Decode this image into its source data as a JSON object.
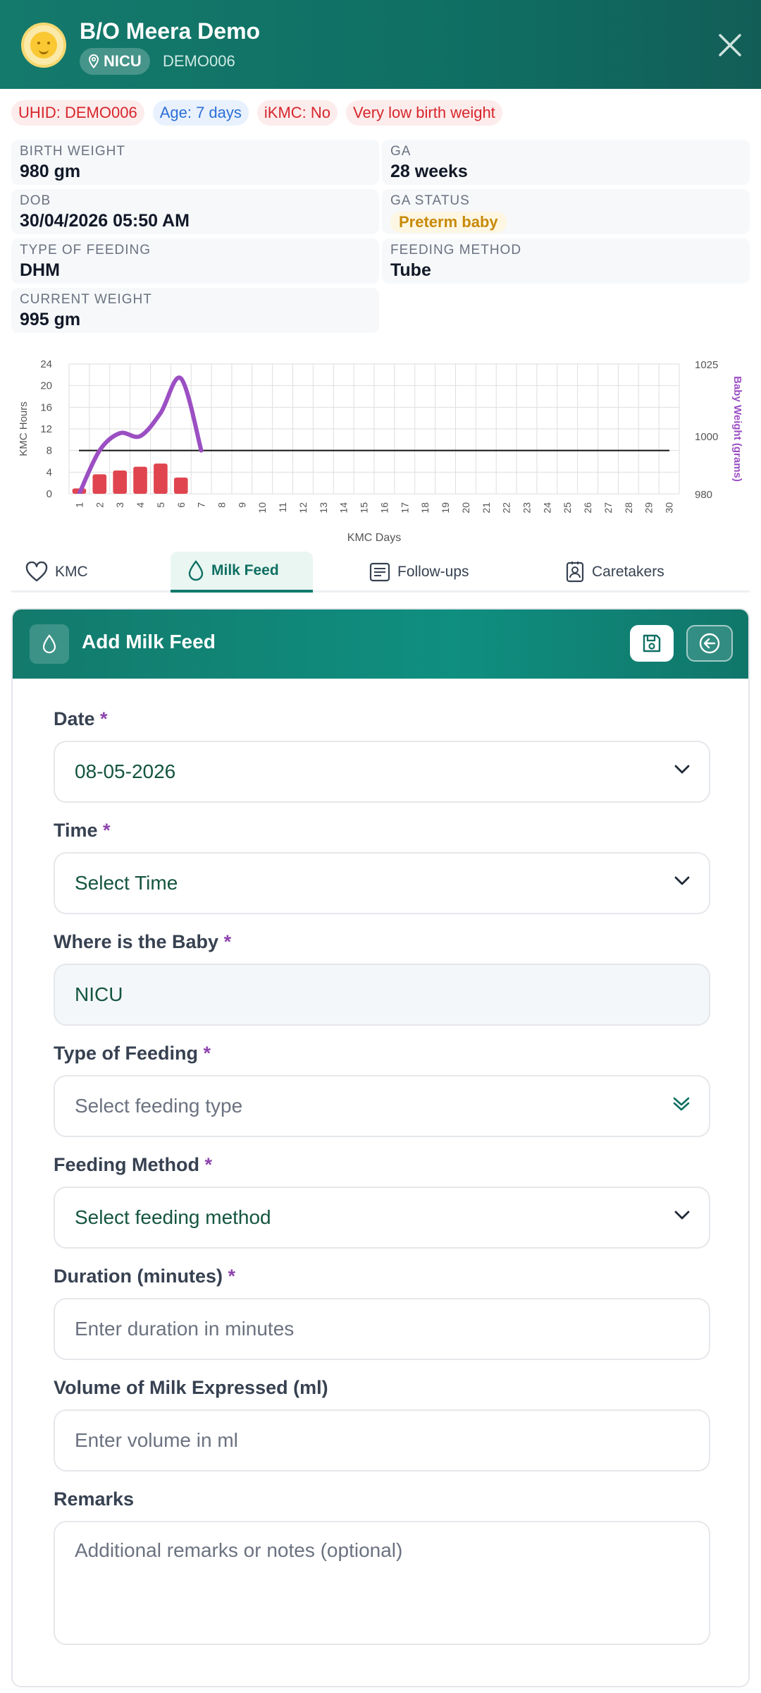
{
  "patient": {
    "name": "B/O Meera Demo",
    "location": "NICU",
    "code": "DEMO006"
  },
  "badges": [
    {
      "text": "UHID: DEMO006",
      "tone": "red"
    },
    {
      "text": "Age: 7 days",
      "tone": "blue"
    },
    {
      "text": "iKMC: No",
      "tone": "red"
    },
    {
      "text": "Very low birth weight",
      "tone": "red"
    }
  ],
  "info": {
    "birth_weight": {
      "label": "BIRTH WEIGHT",
      "value": "980 gm"
    },
    "ga": {
      "label": "GA",
      "value": "28 weeks"
    },
    "dob": {
      "label": "DOB",
      "value": "30/04/2026 05:50 AM"
    },
    "ga_status": {
      "label": "GA STATUS",
      "value": "Preterm baby"
    },
    "type_of_feeding": {
      "label": "TYPE OF FEEDING",
      "value": "DHM"
    },
    "feeding_method": {
      "label": "FEEDING METHOD",
      "value": "Tube"
    },
    "current_weight": {
      "label": "CURRENT WEIGHT",
      "value": "995 gm"
    }
  },
  "chart_data": {
    "type": "bar",
    "xlabel": "KMC Days",
    "ylabel": "KMC Hours",
    "y2label": "Baby Weight (grams)",
    "categories": [
      "1",
      "2",
      "3",
      "4",
      "5",
      "6",
      "7",
      "8",
      "9",
      "10",
      "11",
      "12",
      "13",
      "14",
      "15",
      "16",
      "17",
      "18",
      "19",
      "20",
      "21",
      "22",
      "23",
      "24",
      "25",
      "26",
      "27",
      "28",
      "29",
      "30"
    ],
    "ylim": [
      0,
      24
    ],
    "yticks": [
      0,
      4,
      8,
      12,
      16,
      20,
      24
    ],
    "y2lim": [
      980,
      1025
    ],
    "y2ticks": [
      980,
      1000,
      1025
    ],
    "series": [
      {
        "type": "bar",
        "values": [
          1,
          3.6,
          4.3,
          5,
          5.6,
          3,
          null,
          null,
          null,
          null,
          null,
          null,
          null,
          null,
          null,
          null,
          null,
          null,
          null,
          null,
          null,
          null,
          null,
          null,
          null,
          null,
          null,
          null,
          null,
          null
        ],
        "color": "#e0454f"
      },
      {
        "type": "line",
        "axis": "right",
        "x": [
          1,
          2,
          3,
          4,
          5,
          6,
          7
        ],
        "values": [
          980,
          995,
          1001,
          1000,
          1008,
          1020,
          995
        ],
        "color": "#9b4fc3"
      },
      {
        "type": "hline",
        "value": 8,
        "color": "#111111"
      }
    ],
    "grid": true
  },
  "tabs": [
    {
      "label": "KMC",
      "icon": "heart-icon",
      "active": false
    },
    {
      "label": "Milk Feed",
      "icon": "droplet-icon",
      "active": true
    },
    {
      "label": "Follow-ups",
      "icon": "list-icon",
      "active": false
    },
    {
      "label": "Caretakers",
      "icon": "contact-icon",
      "active": false
    }
  ],
  "form": {
    "title": "Add Milk Feed",
    "required_mark": "*",
    "date": {
      "label": "Date",
      "value": "08-05-2026"
    },
    "time": {
      "label": "Time",
      "value": "Select Time"
    },
    "location": {
      "label": "Where is the Baby",
      "value": "NICU"
    },
    "feeding_type": {
      "label": "Type of Feeding",
      "placeholder": "Select feeding type"
    },
    "feeding_method": {
      "label": "Feeding Method",
      "value": "Select feeding method"
    },
    "duration": {
      "label": "Duration (minutes)",
      "placeholder": "Enter duration in minutes"
    },
    "volume": {
      "label": "Volume of Milk Expressed (ml)",
      "placeholder": "Enter volume in ml"
    },
    "remarks": {
      "label": "Remarks",
      "placeholder": "Additional remarks or notes (optional)"
    }
  },
  "colors": {
    "brand": "#0f7a6c",
    "required": "#8e44ad",
    "bar": "#e0454f",
    "weight_line": "#9b4fc3"
  }
}
